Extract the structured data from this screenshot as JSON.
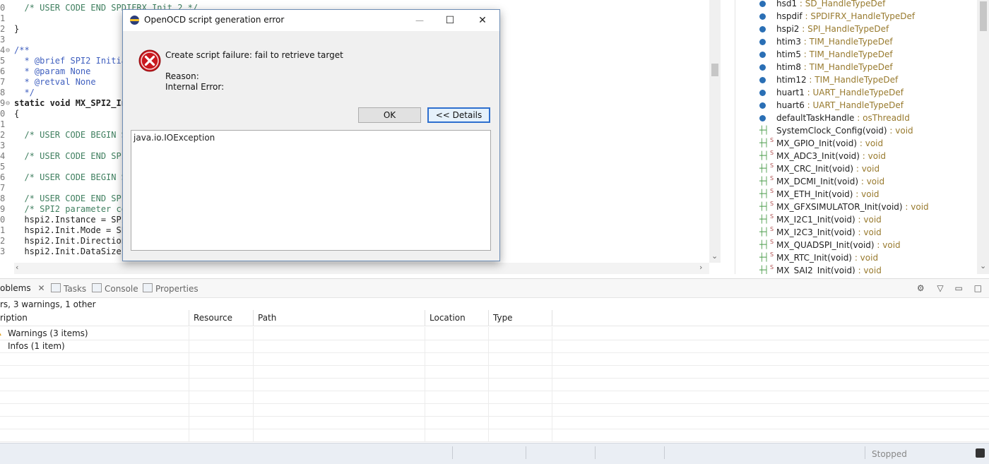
{
  "editor": {
    "lines": [
      {
        "num": "0",
        "fold": "",
        "text": "  /* USER CODE END SPDIFRX_Init 2 */",
        "cls": "cm"
      },
      {
        "num": "1",
        "fold": "",
        "text": "",
        "cls": ""
      },
      {
        "num": "2",
        "fold": "",
        "text": "}",
        "cls": ""
      },
      {
        "num": "3",
        "fold": "",
        "text": "",
        "cls": ""
      },
      {
        "num": "4",
        "fold": "⊖",
        "text": "/**",
        "cls": "cdoc"
      },
      {
        "num": "5",
        "fold": "",
        "text": "  * @brief SPI2 Initia",
        "cls": "cdoc"
      },
      {
        "num": "6",
        "fold": "",
        "text": "  * @param None",
        "cls": "cdoc"
      },
      {
        "num": "7",
        "fold": "",
        "text": "  * @retval None",
        "cls": "cdoc"
      },
      {
        "num": "8",
        "fold": "",
        "text": "  */",
        "cls": "cdoc"
      },
      {
        "num": "9",
        "fold": "⊖",
        "text": "static void MX_SPI2_In",
        "cls": "kwline"
      },
      {
        "num": "0",
        "fold": "",
        "text": "{",
        "cls": ""
      },
      {
        "num": "1",
        "fold": "",
        "text": "",
        "cls": ""
      },
      {
        "num": "2",
        "fold": "",
        "text": "  /* USER CODE BEGIN S",
        "cls": "cm"
      },
      {
        "num": "3",
        "fold": "",
        "text": "",
        "cls": ""
      },
      {
        "num": "4",
        "fold": "",
        "text": "  /* USER CODE END SPI",
        "cls": "cm"
      },
      {
        "num": "5",
        "fold": "",
        "text": "",
        "cls": ""
      },
      {
        "num": "6",
        "fold": "",
        "text": "  /* USER CODE BEGIN S",
        "cls": "cm"
      },
      {
        "num": "7",
        "fold": "",
        "text": "",
        "cls": ""
      },
      {
        "num": "8",
        "fold": "",
        "text": "  /* USER CODE END SPI",
        "cls": "cm"
      },
      {
        "num": "9",
        "fold": "",
        "text": "  /* SPI2 parameter co",
        "cls": "cm"
      },
      {
        "num": "0",
        "fold": "",
        "text": "  hspi2.Instance = SPI",
        "cls": ""
      },
      {
        "num": "1",
        "fold": "",
        "text": "  hspi2.Init.Mode = SP",
        "cls": ""
      },
      {
        "num": "2",
        "fold": "",
        "text": "  hspi2.Init.Direction",
        "cls": ""
      },
      {
        "num": "3",
        "fold": "",
        "text": "  hspi2.Init.DataSize ",
        "cls": ""
      }
    ]
  },
  "outline": {
    "items": [
      {
        "kind": "var",
        "name": "hsd1",
        "type": "SD_HandleTypeDef"
      },
      {
        "kind": "var",
        "name": "hspdif",
        "type": "SPDIFRX_HandleTypeDef"
      },
      {
        "kind": "var",
        "name": "hspi2",
        "type": "SPI_HandleTypeDef"
      },
      {
        "kind": "var",
        "name": "htim3",
        "type": "TIM_HandleTypeDef"
      },
      {
        "kind": "var",
        "name": "htim5",
        "type": "TIM_HandleTypeDef"
      },
      {
        "kind": "var",
        "name": "htim8",
        "type": "TIM_HandleTypeDef"
      },
      {
        "kind": "var",
        "name": "htim12",
        "type": "TIM_HandleTypeDef"
      },
      {
        "kind": "var",
        "name": "huart1",
        "type": "UART_HandleTypeDef"
      },
      {
        "kind": "var",
        "name": "huart6",
        "type": "UART_HandleTypeDef"
      },
      {
        "kind": "var",
        "name": "defaultTaskHandle",
        "type": "osThreadId"
      },
      {
        "kind": "fn",
        "name": "SystemClock_Config(void)",
        "type": "void",
        "static": ""
      },
      {
        "kind": "fn",
        "name": "MX_GPIO_Init(void)",
        "type": "void",
        "static": "S"
      },
      {
        "kind": "fn",
        "name": "MX_ADC3_Init(void)",
        "type": "void",
        "static": "S"
      },
      {
        "kind": "fn",
        "name": "MX_CRC_Init(void)",
        "type": "void",
        "static": "S"
      },
      {
        "kind": "fn",
        "name": "MX_DCMI_Init(void)",
        "type": "void",
        "static": "S"
      },
      {
        "kind": "fn",
        "name": "MX_ETH_Init(void)",
        "type": "void",
        "static": "S"
      },
      {
        "kind": "fn",
        "name": "MX_GFXSIMULATOR_Init(void)",
        "type": "void",
        "static": "S"
      },
      {
        "kind": "fn",
        "name": "MX_I2C1_Init(void)",
        "type": "void",
        "static": "S"
      },
      {
        "kind": "fn",
        "name": "MX_I2C3_Init(void)",
        "type": "void",
        "static": "S"
      },
      {
        "kind": "fn",
        "name": "MX_QUADSPI_Init(void)",
        "type": "void",
        "static": "S"
      },
      {
        "kind": "fn",
        "name": "MX_RTC_Init(void)",
        "type": "void",
        "static": "S"
      },
      {
        "kind": "fn",
        "name": "MX_SAI2_Init(void)",
        "type": "void",
        "static": "S"
      }
    ],
    "type_separator": " : "
  },
  "problems": {
    "tabs": [
      "oblems",
      "Tasks",
      "Console",
      "Properties"
    ],
    "summary": "rs, 3 warnings, 1 other",
    "columns": [
      "ription",
      "Resource",
      "Path",
      "Location",
      "Type"
    ],
    "rows": [
      {
        "description": "Warnings (3 items)"
      },
      {
        "description": "Infos (1 item)"
      }
    ]
  },
  "status": {
    "text": "Stopped"
  },
  "dialog": {
    "title": "OpenOCD script generation error",
    "message": "Create script failure: fail to retrieve target",
    "reason_label": "Reason:",
    "reason_text": "Internal Error:",
    "ok_label": "OK",
    "details_label": "<< Details",
    "details_text": "java.io.IOException",
    "minimize_glyph": "—",
    "maximize_glyph": "☐",
    "close_glyph": "✕"
  }
}
